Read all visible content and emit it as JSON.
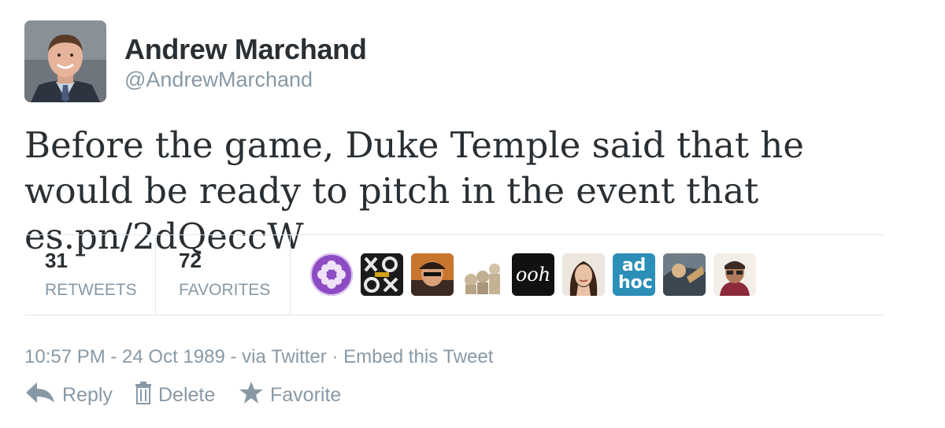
{
  "author": {
    "name": "Andrew Marchand",
    "handle": "@AndrewMarchand"
  },
  "tweet": {
    "text_before_link": "Before the game, Duke Temple said that he would be ready to pitch in the event that ",
    "link_text": "es.pn/2dQeccW"
  },
  "stats": {
    "retweets_count": "31",
    "retweets_label": "RETWEETS",
    "favorites_count": "72",
    "favorites_label": "FAVORITES"
  },
  "favoriters": {
    "avatar_texts": [
      "ooh",
      "ad hoc"
    ]
  },
  "meta": {
    "time": "10:57 PM - 24 Oct 1989",
    "via": "via Twitter",
    "separator": "·",
    "embed_label": "Embed this Tweet"
  },
  "actions": {
    "reply_label": "Reply",
    "delete_label": "Delete",
    "favorite_label": "Favorite"
  },
  "colors": {
    "text_dark": "#292f33",
    "text_muted": "#8899a6",
    "divider": "#e1e8ed"
  }
}
